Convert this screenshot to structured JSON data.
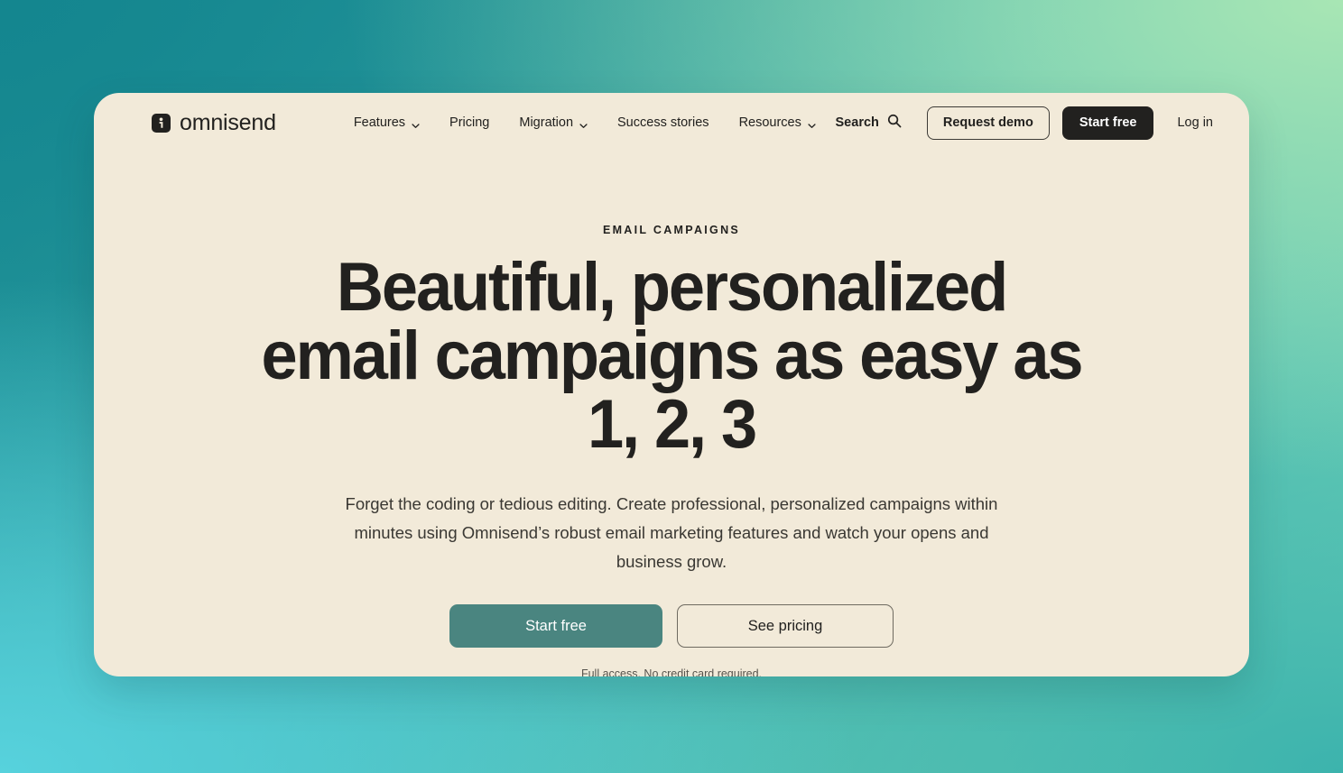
{
  "brand": {
    "name": "omnisend",
    "mark_icon": "omnisend-logo-icon"
  },
  "nav": {
    "items": [
      {
        "label": "Features",
        "has_dropdown": true
      },
      {
        "label": "Pricing",
        "has_dropdown": false
      },
      {
        "label": "Migration",
        "has_dropdown": true
      },
      {
        "label": "Success stories",
        "has_dropdown": false
      },
      {
        "label": "Resources",
        "has_dropdown": true
      }
    ]
  },
  "header_actions": {
    "search_label": "Search",
    "search_icon": "search-icon",
    "request_demo_label": "Request demo",
    "start_free_label": "Start free",
    "login_label": "Log in"
  },
  "hero": {
    "eyebrow": "EMAIL CAMPAIGNS",
    "headline_line1": "Beautiful, personalized",
    "headline_line2": "email campaigns as easy as",
    "headline_line3": "1, 2, 3",
    "subcopy": "Forget the coding or tedious editing. Create professional, personalized campaigns within minutes using Omnisend’s robust email marketing features and watch your opens and business grow.",
    "primary_cta": "Start free",
    "secondary_cta": "See pricing",
    "fineprint": "Full access. No credit card required."
  },
  "colors": {
    "card_background": "#f2ead9",
    "ink": "#22211f",
    "primary_teal": "#4a8580",
    "page_gradient_top_left": "#1a8c94",
    "page_gradient_top_right": "#a8e6b4",
    "page_gradient_bottom_left": "#57d2dd",
    "page_gradient_bottom_right": "#3cb3ad"
  }
}
